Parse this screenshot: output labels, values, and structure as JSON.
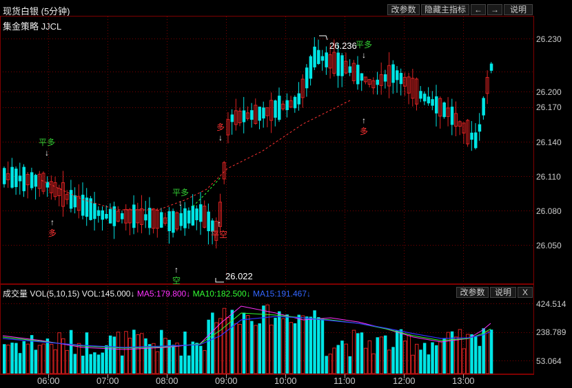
{
  "window": {
    "title": "现货白银 (5分钟)",
    "strategy": "集金策略 JJCL",
    "buttons": [
      "改参数",
      "隐藏主指标",
      "←",
      "→",
      "说明"
    ]
  },
  "price_axis": [
    "26.230",
    "26.200",
    "26.170",
    "26.140",
    "26.110",
    "26.080",
    "26.050"
  ],
  "volume_axis": [
    "424.514",
    "238.789",
    "53.064"
  ],
  "time_axis": [
    "06:00",
    "07:00",
    "08:00",
    "09:00",
    "10:00",
    "11:00",
    "12:00",
    "13:00"
  ],
  "annotations": {
    "high": "26.236",
    "low": "26.022"
  },
  "signals": [
    {
      "label": "平多",
      "color": "#33cc33",
      "arrow": "↓"
    },
    {
      "label": "多",
      "color": "#ff3333",
      "arrow": "↑"
    },
    {
      "label": "平多",
      "color": "#33cc33",
      "arrow": "↓"
    },
    {
      "label": "空",
      "color": "#33cc33",
      "arrow": "↑"
    },
    {
      "label": "平空",
      "color": "#ff3333",
      "arrow": "↑"
    },
    {
      "label": "多",
      "color": "#ff3333",
      "arrow": "↓"
    },
    {
      "label": "平多",
      "color": "#33cc33",
      "arrow": "↓"
    },
    {
      "label": "多",
      "color": "#ff3333",
      "arrow": "↑"
    }
  ],
  "volume_panel": {
    "title": "成交量",
    "vol_params": "VOL(5,10,15)",
    "vol": "VOL:145.000↓",
    "ma5": "MA5:179.800↓",
    "ma10": "MA10:182.500↓",
    "ma15": "MA15:191.467↓",
    "buttons": [
      "改参数",
      "说明",
      "X"
    ]
  },
  "colors": {
    "up": "#dd2222",
    "down": "#00e5e5",
    "ma5": "#ff33ff",
    "ma10": "#33ff33",
    "ma15": "#3333ff",
    "grid": "#800000"
  }
}
